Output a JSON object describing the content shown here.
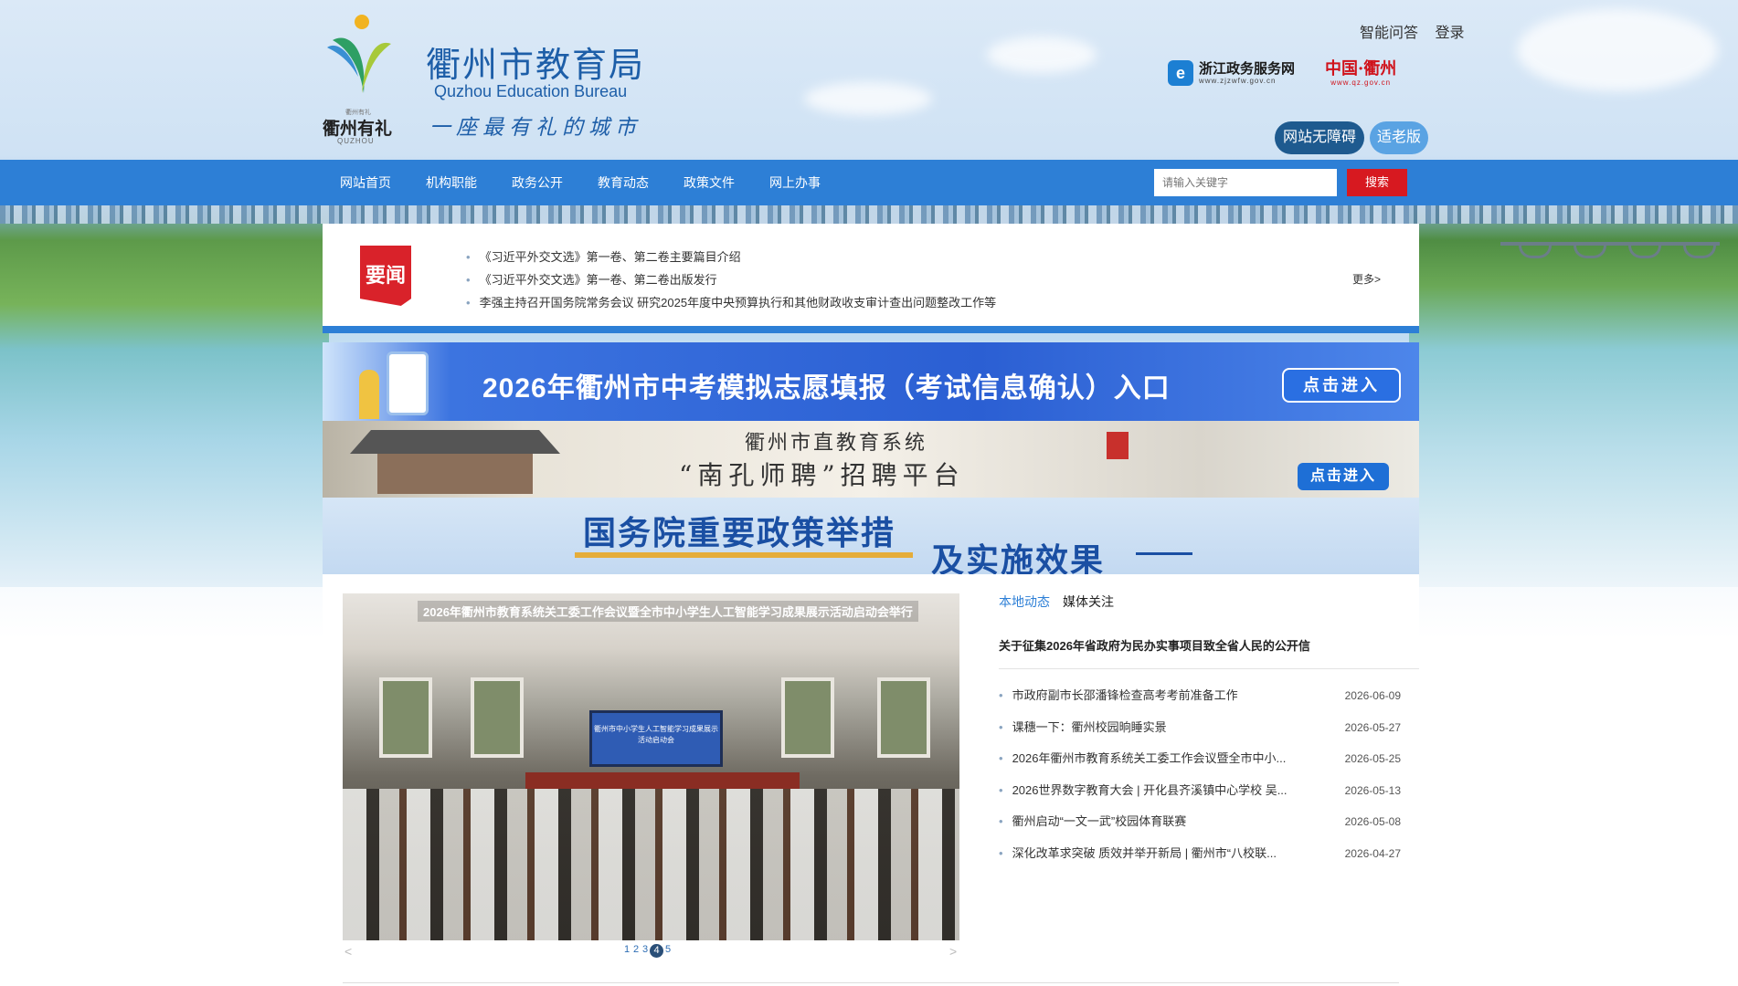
{
  "header": {
    "logo_text": "衢州有礼",
    "logo_tiny": "衢州有礼",
    "logo_sub": "QUZHOU",
    "site_title": "衢州市教育局",
    "site_title_en": "Quzhou Education Bureau",
    "slogan": "一座最有礼的城市",
    "top_links": [
      "智能问答",
      "登录"
    ],
    "partner_zj": {
      "name": "浙江政务服务网",
      "url": "www.zjzwfw.gov.cn"
    },
    "partner_qz": {
      "name": "中国·衢州",
      "url": "www.qz.gov.cn"
    },
    "accessibility_label": "网站无障碍",
    "elder_label": "适老版"
  },
  "nav": {
    "items": [
      "网站首页",
      "机构职能",
      "政务公开",
      "教育动态",
      "政策文件",
      "网上办事"
    ],
    "search_placeholder": "请输入关键字",
    "search_button": "搜索"
  },
  "news": {
    "badge": "要闻",
    "items": [
      "《习近平外交文选》第一卷、第二卷主要篇目介绍",
      "《习近平外交文选》第一卷、第二卷出版发行",
      "李强主持召开国务院常务会议 研究2025年度中央预算执行和其他财政收支审计查出问题整改工作等"
    ],
    "more": "更多>"
  },
  "banners": {
    "b1_text": "2026年衢州市中考模拟志愿填报（考试信息确认）入口",
    "b1_button": "点击进入",
    "b2_line1": "衢州市直教育系统",
    "b2_line2": "“南孔师聘”招聘平台",
    "b2_button": "点击进入",
    "b3_line1": "国务院重要政策举措",
    "b3_line2": "及实施效果"
  },
  "slider": {
    "caption": "2026年衢州市教育系统关工委工作会议暨全市中小学生人工智能学习成果展示活动启动会举行",
    "screen_text": "衢州市中小学生人工智能学习成果展示活动启动会",
    "pages": [
      "1",
      "2",
      "3",
      "4",
      "5"
    ],
    "active_page": "4",
    "prev": "<",
    "next": ">"
  },
  "tabs": [
    "本地动态",
    "媒体关注"
  ],
  "headline": "关于征集2026年省政府为民办实事项目致全省人民的公开信",
  "articles": [
    {
      "title": "市政府副市长邵潘锋检查高考考前准备工作",
      "date": "2026-06-09"
    },
    {
      "title": "课穗一下：衢州校园晌睡实景",
      "date": "2026-05-27"
    },
    {
      "title": "2026年衢州市教育系统关工委工作会议暨全市中小...",
      "date": "2026-05-25"
    },
    {
      "title": "2026世界数字教育大会 | 开化县齐溪镇中心学校 吴...",
      "date": "2026-05-13"
    },
    {
      "title": "衢州启动“一文一武”校园体育联赛",
      "date": "2026-05-08"
    },
    {
      "title": "深化改革求突破 质效并举开新局 | 衢州市“八校联...",
      "date": "2026-04-27"
    }
  ],
  "colors": {
    "nav_blue": "#2d7fd6",
    "search_red": "#d71920",
    "badge_red": "#d9222a",
    "title_blue": "#1d5ea8"
  }
}
